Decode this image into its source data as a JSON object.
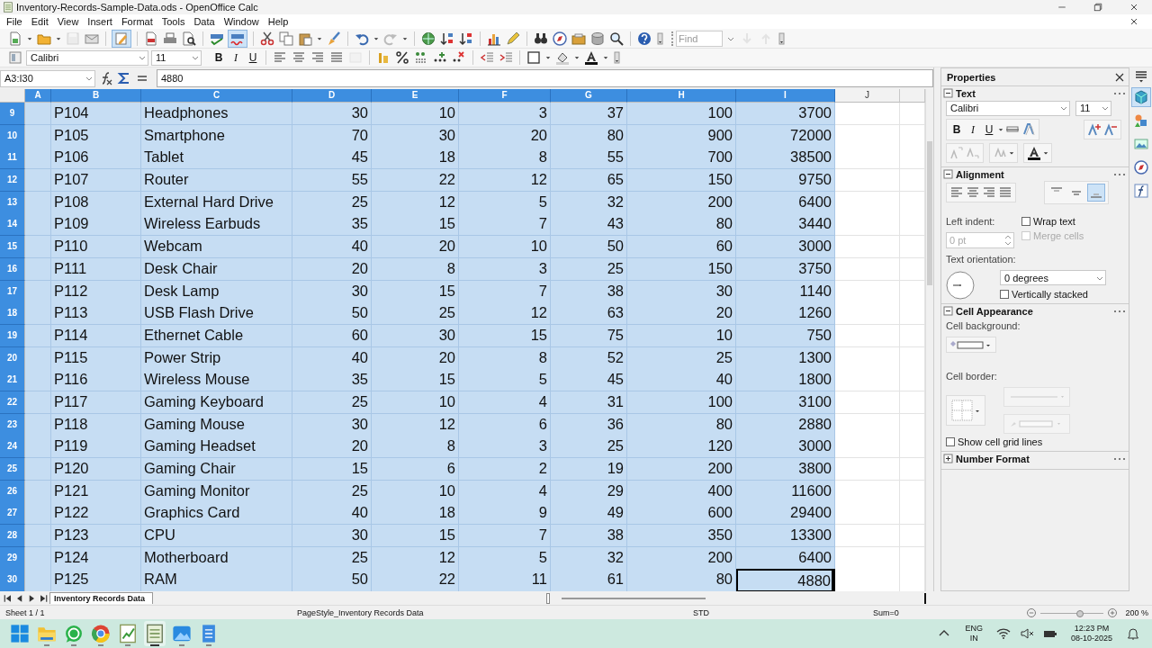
{
  "window": {
    "title": "Inventory-Records-Sample-Data.ods - OpenOffice Calc"
  },
  "menu": [
    "File",
    "Edit",
    "View",
    "Insert",
    "Format",
    "Tools",
    "Data",
    "Window",
    "Help"
  ],
  "toolbar": {
    "edit_mode": {
      "on": true
    },
    "auto_spellcheck": {
      "on": true
    },
    "find_field": {
      "placeholder": "Find"
    }
  },
  "format_toolbar": {
    "font_name": "Calibri",
    "font_size": "11",
    "style_buttons": [
      "B",
      "I",
      "U"
    ]
  },
  "formula_bar": {
    "cell_reference": "A3:I30",
    "formula": "4880"
  },
  "sheet": {
    "columns": [
      {
        "label": "A",
        "selected": true
      },
      {
        "label": "B",
        "selected": true
      },
      {
        "label": "C",
        "selected": true
      },
      {
        "label": "D",
        "selected": true
      },
      {
        "label": "E",
        "selected": true
      },
      {
        "label": "F",
        "selected": true
      },
      {
        "label": "G",
        "selected": true
      },
      {
        "label": "H",
        "selected": true
      },
      {
        "label": "I",
        "selected": true
      },
      {
        "label": "J",
        "selected": false
      }
    ],
    "rows": [
      {
        "number": "9",
        "selected": true,
        "cursor": false,
        "cells": [
          "",
          "P104",
          "Headphones",
          "30",
          "10",
          "3",
          "37",
          "100",
          "3700"
        ]
      },
      {
        "number": "10",
        "selected": true,
        "cursor": false,
        "cells": [
          "",
          "P105",
          "Smartphone",
          "70",
          "30",
          "20",
          "80",
          "900",
          "72000"
        ]
      },
      {
        "number": "11",
        "selected": true,
        "cursor": false,
        "cells": [
          "",
          "P106",
          "Tablet",
          "45",
          "18",
          "8",
          "55",
          "700",
          "38500"
        ]
      },
      {
        "number": "12",
        "selected": true,
        "cursor": false,
        "cells": [
          "",
          "P107",
          "Router",
          "55",
          "22",
          "12",
          "65",
          "150",
          "9750"
        ]
      },
      {
        "number": "13",
        "selected": true,
        "cursor": false,
        "cells": [
          "",
          "P108",
          "External Hard Drive",
          "25",
          "12",
          "5",
          "32",
          "200",
          "6400"
        ]
      },
      {
        "number": "14",
        "selected": true,
        "cursor": false,
        "cells": [
          "",
          "P109",
          "Wireless Earbuds",
          "35",
          "15",
          "7",
          "43",
          "80",
          "3440"
        ]
      },
      {
        "number": "15",
        "selected": true,
        "cursor": false,
        "cells": [
          "",
          "P110",
          "Webcam",
          "40",
          "20",
          "10",
          "50",
          "60",
          "3000"
        ]
      },
      {
        "number": "16",
        "selected": true,
        "cursor": false,
        "cells": [
          "",
          "P111",
          "Desk Chair",
          "20",
          "8",
          "3",
          "25",
          "150",
          "3750"
        ]
      },
      {
        "number": "17",
        "selected": true,
        "cursor": false,
        "cells": [
          "",
          "P112",
          "Desk Lamp",
          "30",
          "15",
          "7",
          "38",
          "30",
          "1140"
        ]
      },
      {
        "number": "18",
        "selected": true,
        "cursor": false,
        "cells": [
          "",
          "P113",
          "USB Flash Drive",
          "50",
          "25",
          "12",
          "63",
          "20",
          "1260"
        ]
      },
      {
        "number": "19",
        "selected": true,
        "cursor": false,
        "cells": [
          "",
          "P114",
          "Ethernet Cable",
          "60",
          "30",
          "15",
          "75",
          "10",
          "750"
        ]
      },
      {
        "number": "20",
        "selected": true,
        "cursor": false,
        "cells": [
          "",
          "P115",
          "Power Strip",
          "40",
          "20",
          "8",
          "52",
          "25",
          "1300"
        ]
      },
      {
        "number": "21",
        "selected": true,
        "cursor": false,
        "cells": [
          "",
          "P116",
          "Wireless Mouse",
          "35",
          "15",
          "5",
          "45",
          "40",
          "1800"
        ]
      },
      {
        "number": "22",
        "selected": true,
        "cursor": false,
        "cells": [
          "",
          "P117",
          "Gaming Keyboard",
          "25",
          "10",
          "4",
          "31",
          "100",
          "3100"
        ]
      },
      {
        "number": "23",
        "selected": true,
        "cursor": false,
        "cells": [
          "",
          "P118",
          "Gaming Mouse",
          "30",
          "12",
          "6",
          "36",
          "80",
          "2880"
        ]
      },
      {
        "number": "24",
        "selected": true,
        "cursor": false,
        "cells": [
          "",
          "P119",
          "Gaming Headset",
          "20",
          "8",
          "3",
          "25",
          "120",
          "3000"
        ]
      },
      {
        "number": "25",
        "selected": true,
        "cursor": false,
        "cells": [
          "",
          "P120",
          "Gaming Chair",
          "15",
          "6",
          "2",
          "19",
          "200",
          "3800"
        ]
      },
      {
        "number": "26",
        "selected": true,
        "cursor": false,
        "cells": [
          "",
          "P121",
          "Gaming Monitor",
          "25",
          "10",
          "4",
          "29",
          "400",
          "11600"
        ]
      },
      {
        "number": "27",
        "selected": true,
        "cursor": false,
        "cells": [
          "",
          "P122",
          "Graphics Card",
          "40",
          "18",
          "9",
          "49",
          "600",
          "29400"
        ]
      },
      {
        "number": "28",
        "selected": true,
        "cursor": false,
        "cells": [
          "",
          "P123",
          "CPU",
          "30",
          "15",
          "7",
          "38",
          "350",
          "13300"
        ]
      },
      {
        "number": "29",
        "selected": true,
        "cursor": false,
        "cells": [
          "",
          "P124",
          "Motherboard",
          "25",
          "12",
          "5",
          "32",
          "200",
          "6400"
        ]
      },
      {
        "number": "30",
        "selected": true,
        "cursor": true,
        "cells": [
          "",
          "P125",
          "RAM",
          "50",
          "22",
          "11",
          "61",
          "80",
          "4880"
        ]
      }
    ]
  },
  "sheet_tabs": [
    {
      "label": "Inventory Records Data",
      "selected": true
    }
  ],
  "status_bar": {
    "sheet": "Sheet 1 / 1",
    "page_style": "PageStyle_Inventory Records Data",
    "mode": "STD",
    "sum": "Sum=0",
    "zoom_slider": {
      "level": 0.62
    },
    "zoom": "200 %"
  },
  "sidebar": {
    "title": "Properties",
    "sections": [
      {
        "kind": "text",
        "title": "Text",
        "expanded": true,
        "font_name": "Calibri",
        "font_size": "11",
        "style_buttons": [
          "B",
          "I",
          "U"
        ]
      },
      {
        "kind": "alignment",
        "title": "Alignment",
        "expanded": true,
        "vertical_align": [
          {
            "selected": false
          },
          {
            "selected": false
          },
          {
            "selected": true
          }
        ],
        "left_indent_label": "Left indent:",
        "left_indent": {
          "value": "0 pt",
          "disabled": true
        },
        "wrap_text": {
          "label": "Wrap text",
          "checked": false,
          "disabled": false
        },
        "merge_cells": {
          "label": "Merge cells",
          "checked": false,
          "disabled": true
        },
        "orientation_label": "Text orientation:",
        "orientation": "0 degrees",
        "vertically_stacked": {
          "label": "Vertically stacked",
          "checked": false,
          "disabled": false
        }
      },
      {
        "kind": "cell_appearance",
        "title": "Cell Appearance",
        "expanded": true,
        "background_label": "Cell background:",
        "border_label": "Cell border:",
        "grid_lines": {
          "label": "Show cell grid lines",
          "checked": false,
          "disabled": false
        }
      },
      {
        "kind": "number_format",
        "title": "Number Format",
        "expanded": false
      }
    ],
    "deck_tabs": [
      {
        "selected": true
      },
      {
        "selected": false
      },
      {
        "selected": false
      },
      {
        "selected": false
      },
      {
        "selected": false
      }
    ]
  },
  "taskbar": {
    "apps": [
      {
        "selected": false
      },
      {
        "selected": false
      },
      {
        "selected": false
      },
      {
        "selected": false
      },
      {
        "selected": false
      },
      {
        "selected": true
      },
      {
        "selected": false
      },
      {
        "selected": false
      }
    ],
    "tray": {
      "language": "ENG",
      "region": "IN",
      "time": "12:23 PM",
      "date": "08-10-2025"
    }
  }
}
